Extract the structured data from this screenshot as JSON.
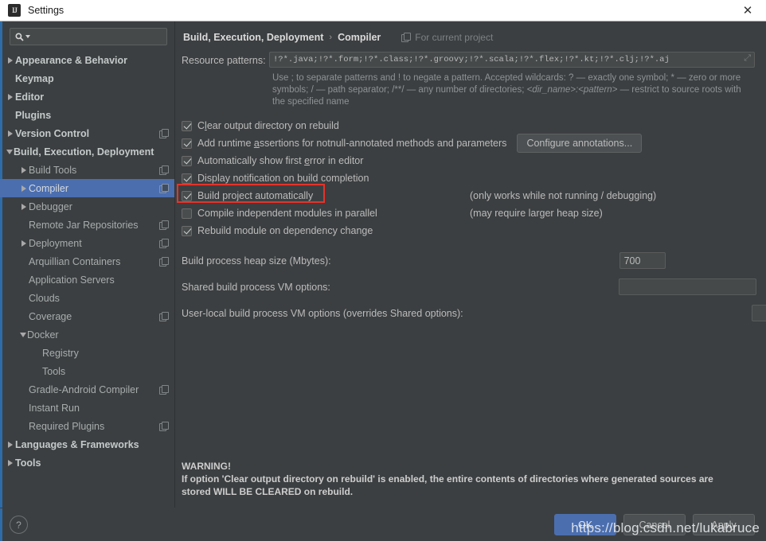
{
  "window": {
    "title": "Settings",
    "app_icon": "intellij-idea-icon",
    "close_label": "✕"
  },
  "search": {
    "placeholder": "",
    "value": "",
    "icon": "search-icon"
  },
  "sidebar": {
    "items": [
      {
        "label": "Appearance & Behavior",
        "indent": 0,
        "twisty": "right",
        "bold": true,
        "project_icon": false,
        "selected": false
      },
      {
        "label": "Keymap",
        "indent": 0,
        "twisty": "none",
        "bold": true,
        "project_icon": false,
        "selected": false
      },
      {
        "label": "Editor",
        "indent": 0,
        "twisty": "right",
        "bold": true,
        "project_icon": false,
        "selected": false
      },
      {
        "label": "Plugins",
        "indent": 0,
        "twisty": "none",
        "bold": true,
        "project_icon": false,
        "selected": false
      },
      {
        "label": "Version Control",
        "indent": 0,
        "twisty": "right",
        "bold": true,
        "project_icon": true,
        "selected": false
      },
      {
        "label": "Build, Execution, Deployment",
        "indent": 0,
        "twisty": "down",
        "bold": true,
        "project_icon": false,
        "selected": false
      },
      {
        "label": "Build Tools",
        "indent": 1,
        "twisty": "right",
        "bold": false,
        "project_icon": true,
        "selected": false
      },
      {
        "label": "Compiler",
        "indent": 1,
        "twisty": "right",
        "bold": false,
        "project_icon": true,
        "selected": true
      },
      {
        "label": "Debugger",
        "indent": 1,
        "twisty": "right",
        "bold": false,
        "project_icon": false,
        "selected": false
      },
      {
        "label": "Remote Jar Repositories",
        "indent": 1,
        "twisty": "none",
        "bold": false,
        "project_icon": true,
        "selected": false
      },
      {
        "label": "Deployment",
        "indent": 1,
        "twisty": "right",
        "bold": false,
        "project_icon": true,
        "selected": false
      },
      {
        "label": "Arquillian Containers",
        "indent": 1,
        "twisty": "none",
        "bold": false,
        "project_icon": true,
        "selected": false
      },
      {
        "label": "Application Servers",
        "indent": 1,
        "twisty": "none",
        "bold": false,
        "project_icon": false,
        "selected": false
      },
      {
        "label": "Clouds",
        "indent": 1,
        "twisty": "none",
        "bold": false,
        "project_icon": false,
        "selected": false
      },
      {
        "label": "Coverage",
        "indent": 1,
        "twisty": "none",
        "bold": false,
        "project_icon": true,
        "selected": false
      },
      {
        "label": "Docker",
        "indent": 1,
        "twisty": "down",
        "bold": false,
        "project_icon": false,
        "selected": false
      },
      {
        "label": "Registry",
        "indent": 2,
        "twisty": "none",
        "bold": false,
        "project_icon": false,
        "selected": false
      },
      {
        "label": "Tools",
        "indent": 2,
        "twisty": "none",
        "bold": false,
        "project_icon": false,
        "selected": false
      },
      {
        "label": "Gradle-Android Compiler",
        "indent": 1,
        "twisty": "none",
        "bold": false,
        "project_icon": true,
        "selected": false
      },
      {
        "label": "Instant Run",
        "indent": 1,
        "twisty": "none",
        "bold": false,
        "project_icon": false,
        "selected": false
      },
      {
        "label": "Required Plugins",
        "indent": 1,
        "twisty": "none",
        "bold": false,
        "project_icon": true,
        "selected": false
      },
      {
        "label": "Languages & Frameworks",
        "indent": 0,
        "twisty": "right",
        "bold": true,
        "project_icon": false,
        "selected": false
      },
      {
        "label": "Tools",
        "indent": 0,
        "twisty": "right",
        "bold": true,
        "project_icon": false,
        "selected": false
      }
    ]
  },
  "main": {
    "breadcrumb": {
      "root": "Build, Execution, Deployment",
      "separator": "›",
      "leaf": "Compiler"
    },
    "for_current_project": "For current project",
    "resource_patterns": {
      "label": "Resource patterns:",
      "value": "!?*.java;!?*.form;!?*.class;!?*.groovy;!?*.scala;!?*.flex;!?*.kt;!?*.clj;!?*.aj",
      "expand_icon": "expand-icon"
    },
    "hint_part1": "Use ; to separate patterns and ! to negate a pattern. Accepted wildcards: ? — exactly one symbol; * — zero or more symbols; / — path separator; /**/ — any number of directories; ",
    "hint_italic1": "<dir_name>:<pattern>",
    "hint_part2": " — restrict to source roots with the specified name",
    "options": [
      {
        "label_before": "C",
        "mnemonic": "l",
        "label_after": "ear output directory on rebuild",
        "checked": true,
        "note": "",
        "highlighted": false
      },
      {
        "label_before": "Add runtime ",
        "mnemonic": "a",
        "label_after": "ssertions for notnull-annotated methods and parameters",
        "checked": true,
        "note": "",
        "highlighted": false
      },
      {
        "label_before": "Automatically show first ",
        "mnemonic": "e",
        "label_after": "rror in editor",
        "checked": true,
        "note": "",
        "highlighted": false
      },
      {
        "label_before": "Display notification on build completion",
        "mnemonic": "",
        "label_after": "",
        "checked": true,
        "note": "",
        "highlighted": false
      },
      {
        "label_before": "Build project automatically",
        "mnemonic": "",
        "label_after": "",
        "checked": true,
        "note": "(only works while not running / debugging)",
        "highlighted": true
      },
      {
        "label_before": "Compile independent modules in parallel",
        "mnemonic": "",
        "label_after": "",
        "checked": false,
        "note": "(may require larger heap size)",
        "highlighted": false
      },
      {
        "label_before": "Rebuild module on dependency change",
        "mnemonic": "",
        "label_after": "",
        "checked": true,
        "note": "",
        "highlighted": false
      }
    ],
    "configure_annotations_button": "Configure annotations...",
    "fields": [
      {
        "label": "Build process heap size (Mbytes):",
        "value": "700",
        "kind": "small"
      },
      {
        "label": "Shared build process VM options:",
        "value": "",
        "kind": "wide"
      },
      {
        "label": "User-local build process VM options (overrides Shared options):",
        "value": "",
        "kind": "wide"
      }
    ],
    "warning": {
      "heading": "WARNING!",
      "line1": "If option 'Clear output directory on rebuild' is enabled, the entire contents of directories where generated sources are",
      "line2": "stored WILL BE CLEARED on rebuild."
    }
  },
  "footer": {
    "help_label": "?",
    "ok_label": "OK",
    "cancel_label": "Cancel",
    "apply_label": "Apply",
    "watermark": "https://blog.csdn.net/lukabruce"
  },
  "colors": {
    "accent": "#4b6eaf",
    "highlight_box": "#e8322a",
    "panel_bg": "#3c3f41",
    "field_bg": "#45494a",
    "left_edge": "#2d6ca8"
  }
}
